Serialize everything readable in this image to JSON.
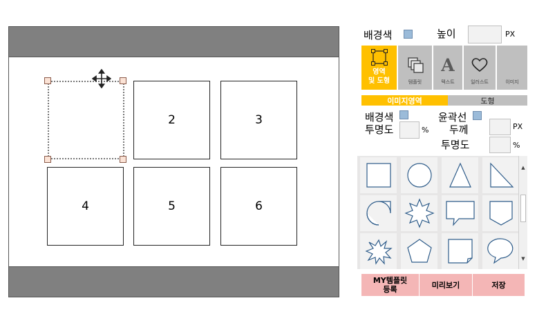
{
  "canvas": {
    "cells": [
      "2",
      "3",
      "4",
      "5",
      "6"
    ]
  },
  "panel": {
    "bg_label": "배경색",
    "height_label": "높이",
    "height_value": "",
    "height_unit": "PX",
    "tools": [
      {
        "label": "영역\n및 도형",
        "icon": "region-icon"
      },
      {
        "label": "템플릿",
        "icon": "template-icon"
      },
      {
        "label": "텍스트",
        "icon": "text-icon"
      },
      {
        "label": "일러스트",
        "icon": "heart-icon"
      },
      {
        "label": "이미지",
        "icon": "image-icon"
      }
    ],
    "tabs": [
      "이미지영역",
      "도형"
    ],
    "shape_bg_label": "배경색",
    "outline_label": "윤곽선",
    "opacity_label": "투명도",
    "opacity_unit": "%",
    "thickness_label": "두께",
    "thickness_unit": "PX",
    "outline_opacity_label": "투명도",
    "outline_opacity_unit": "%",
    "shapes": [
      "rectangle",
      "circle",
      "triangle",
      "right-triangle",
      "teardrop",
      "star-8",
      "callout-rect",
      "pentagon-arrow",
      "explosion",
      "pentagon",
      "folded-corner",
      "callout-oval"
    ],
    "buttons": {
      "register": "MY템플릿\n등록",
      "preview": "미리보기",
      "save": "저장"
    },
    "colors": {
      "active_tool": "#ffc000",
      "tool_bg": "#bfbfbf",
      "button_bg": "#f4b6b6",
      "swatch": "#9bbbd9"
    }
  }
}
